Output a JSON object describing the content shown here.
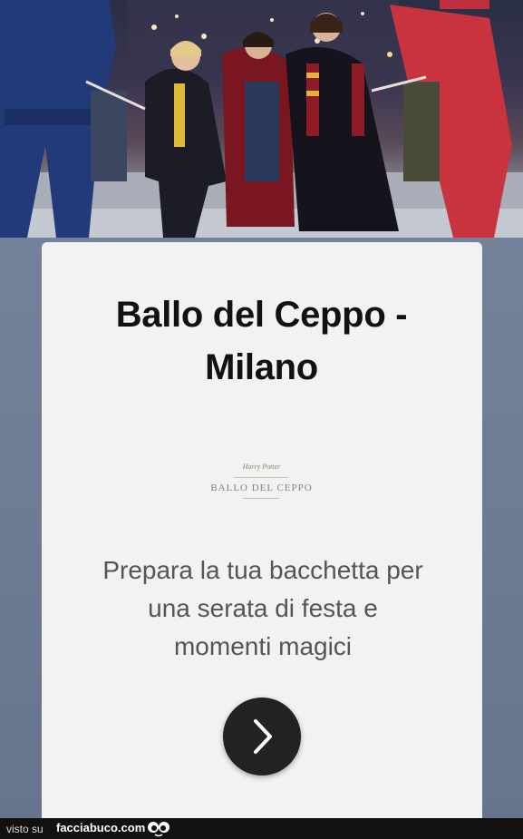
{
  "hero": {
    "alt_semantic": "photo-banner"
  },
  "card": {
    "title_line1": "Ballo del Ceppo -",
    "title_line2": "Milano",
    "logo_small": "Harry Potter",
    "logo_main": "BALLO DEL CEPPO",
    "tagline_line1": "Prepara la tua bacchetta per",
    "tagline_line2": "una serata di festa e",
    "tagline_line3": "momenti magici",
    "next_icon": "chevron-right-icon"
  },
  "footer": {
    "visto_label": "visto su",
    "site_label": "facciabuco.com",
    "logo_icon": "eyes-icon"
  },
  "colors": {
    "card_bg": "#f2f2f2",
    "button_bg": "#222222",
    "backdrop": "#6d7b94",
    "footer_bg": "#111111"
  }
}
